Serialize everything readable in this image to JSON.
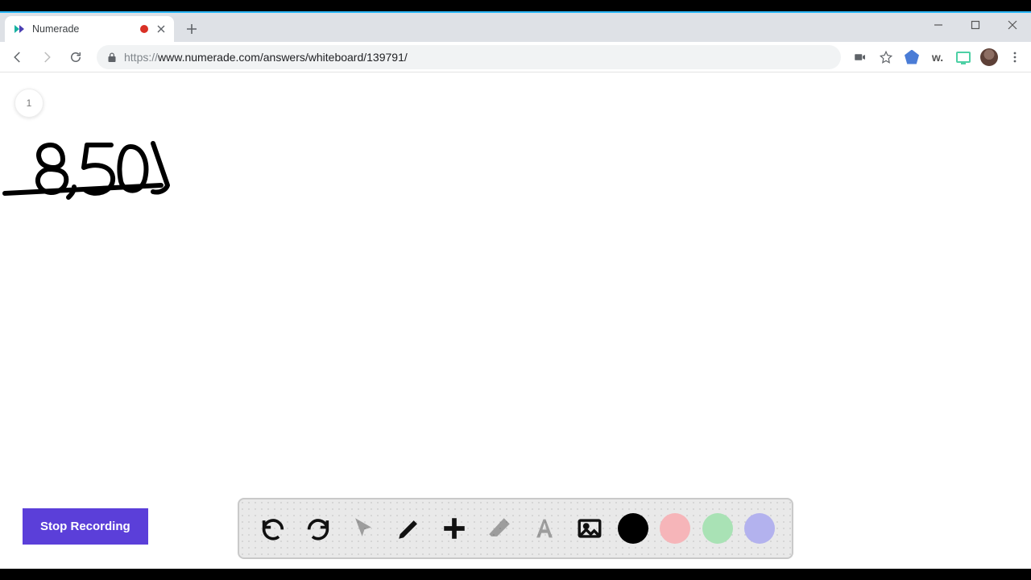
{
  "browser": {
    "tab_title": "Numerade",
    "url_scheme": "https://",
    "url_rest": "www.numerade.com/answers/whiteboard/139791/"
  },
  "whiteboard": {
    "page_badge": "1",
    "stop_button": "Stop Recording"
  },
  "ext_w_label": "w."
}
